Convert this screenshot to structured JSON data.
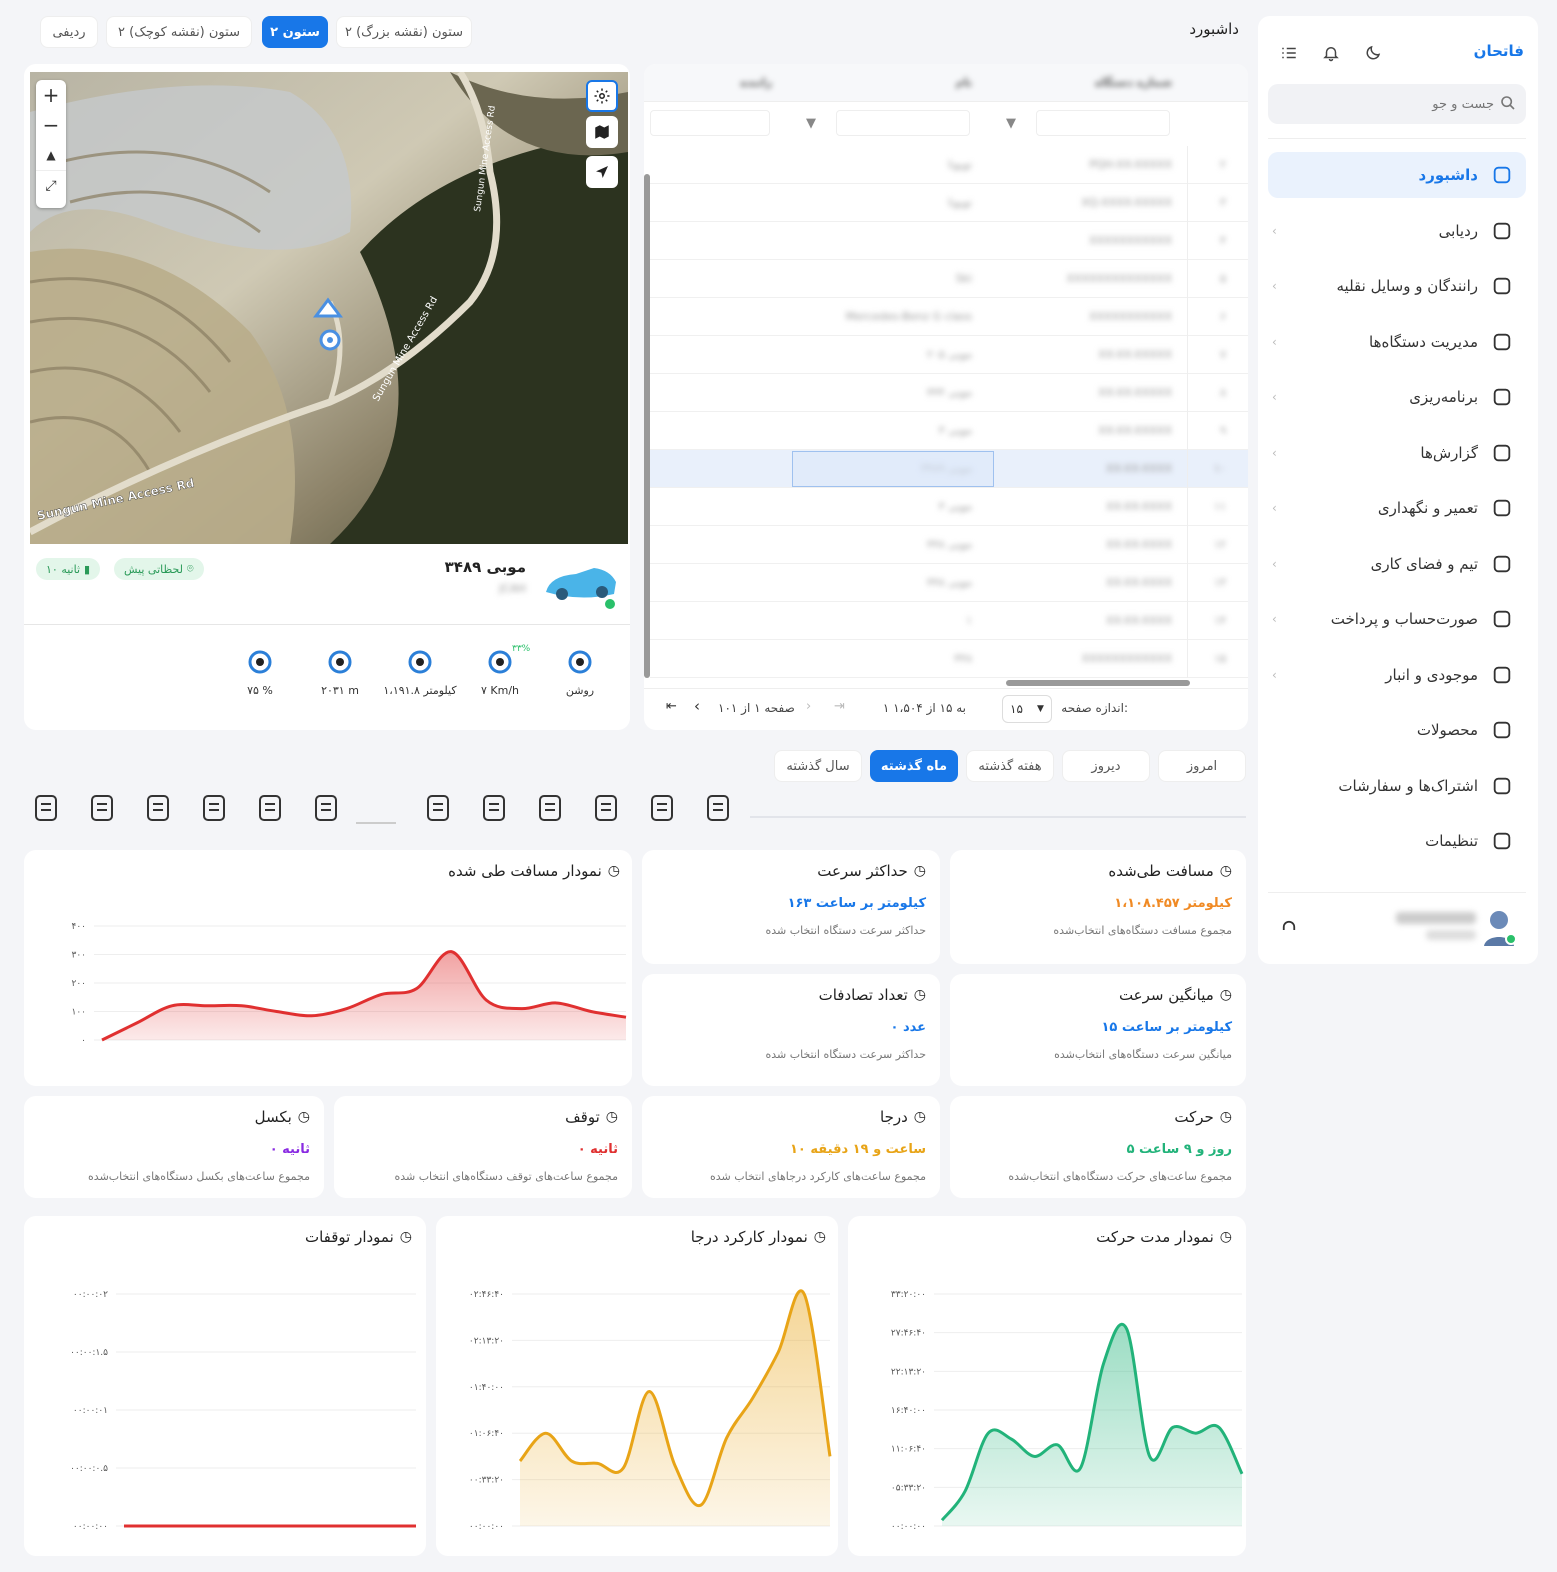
{
  "sidebar": {
    "brand": "فاتحان",
    "search_placeholder": "جست و جو",
    "items": [
      {
        "label": "داشبورد",
        "icon": "home-icon",
        "active": true
      },
      {
        "label": "ردیابی",
        "icon": "crosshair-icon"
      },
      {
        "label": "رانندگان و وسایل نقلیه",
        "icon": "car-icon"
      },
      {
        "label": "مدیریت دستگاه‌ها",
        "icon": "device-icon"
      },
      {
        "label": "برنامه‌ریزی",
        "icon": "clock-icon"
      },
      {
        "label": "گزارش‌ها",
        "icon": "bar-chart-icon"
      },
      {
        "label": "تعمیر و نگهداری",
        "icon": "maintenance-icon"
      },
      {
        "label": "تیم و فضای کاری",
        "icon": "team-icon"
      },
      {
        "label": "صورت‌حساب و پرداخت",
        "icon": "card-icon"
      },
      {
        "label": "موجودی و انبار",
        "icon": "warehouse-icon"
      },
      {
        "label": "محصولات",
        "icon": "boxes-icon"
      },
      {
        "label": "اشتراک‌ها و سفارشات",
        "icon": "cart-icon"
      },
      {
        "label": "تنظیمات",
        "icon": "gear-icon"
      }
    ]
  },
  "header": {
    "title": "داشبورد",
    "layouts": [
      {
        "label": "ردیفی",
        "on": false
      },
      {
        "label": "۲ ستون (نقشه کوچک)",
        "on": false
      },
      {
        "label": "۲ ستون",
        "on": true
      },
      {
        "label": "۲ ستون (نقشه بزرگ)",
        "on": false
      }
    ]
  },
  "table": {
    "columns": [
      "شماره دستگاه",
      "نام",
      "راننده"
    ],
    "rows": [
      {
        "n": "۲",
        "dev": "PQH-XX-XXXXX",
        "name": "تویوتا"
      },
      {
        "n": "۳",
        "dev": "XQ-XXXX-XXXXX",
        "name": "تویوتا"
      },
      {
        "n": "۴",
        "dev": "XXXXXXXXXXX",
        "name": ""
      },
      {
        "n": "۵",
        "dev": "XXXXXXXXXXXXXX",
        "name": "Ski"
      },
      {
        "n": "۶",
        "dev": "XXXXXXXXXXX",
        "name": "Mercedes-Benz G class"
      },
      {
        "n": "۷",
        "dev": "XX-XX-XXXXX",
        "name": "موبی ۲۰۵"
      },
      {
        "n": "۸",
        "dev": "XX-XX-XXXXX",
        "name": "موبی ۴۴۴"
      },
      {
        "n": "۹",
        "dev": "XX-XX-XXXXX",
        "name": "موبی ۳"
      },
      {
        "n": "۱۰",
        "dev": "XX-XX-XXXX",
        "name": "موبی ۳۴۸۹",
        "selected": true
      },
      {
        "n": "۱۱",
        "dev": "XX-XX-XXXX",
        "name": "موبی ۳"
      },
      {
        "n": "۱۲",
        "dev": "XX-XX-XXXX",
        "name": "موبی ۴۴۸"
      },
      {
        "n": "۱۳",
        "dev": "XX-XX-XXXX",
        "name": "موبی ۴۴۸"
      },
      {
        "n": "۱۴",
        "dev": "XX-XX-XXXX",
        "name": "۱"
      },
      {
        "n": "۱۵",
        "dev": "XXXXXXXXXXXX",
        "name": "۴۴۸"
      }
    ],
    "page_size_label": "اندازه صفحه:",
    "page_size": "۱۵",
    "range": "۱ به ۱۵ از ۱،۵۰۴",
    "page_info": "صفحه ۱ از ۱۰۱"
  },
  "map": {
    "road1": "Sungun Mine Access Rd",
    "road2": "Sungun Mine Access Rd",
    "road3": "Sungun Mine Access Rd",
    "vehicle_name": "موبی ۳۴۸۹",
    "vehicle_sub": "JCAH",
    "badge_live": "لحظاتی پیش",
    "badge_interval": "۱۰ ثانیه",
    "metrics": [
      {
        "icon": "ignition-icon",
        "label": "روشن"
      },
      {
        "icon": "speedometer-icon",
        "label": "۷ Km/h",
        "extra": "۳۳%"
      },
      {
        "icon": "route-icon",
        "label": "۱،۱۹۱.۸ کیلومتر"
      },
      {
        "icon": "altitude-icon",
        "label": "۲۰۳۱ m"
      },
      {
        "icon": "signal-icon",
        "label": "۷۵ %"
      }
    ]
  },
  "periods": [
    {
      "label": "امروز",
      "on": false
    },
    {
      "label": "دیروز",
      "on": false
    },
    {
      "label": "هفته گذشته",
      "on": false
    },
    {
      "label": "ماه گذشته",
      "on": true
    },
    {
      "label": "سال گذشته",
      "on": false
    }
  ],
  "toolbar_icons": [
    "report-icon",
    "route-pin-icon",
    "parking-icon",
    "alarm-icon",
    "database-icon",
    "coins-icon",
    "divider",
    "alarm-gear-icon",
    "settings-laptop-icon",
    "edit-icon",
    "location-pin-icon",
    "terminal-icon",
    "io-gear-icon"
  ],
  "stats": {
    "distance": {
      "title": "مسافت طی‌شده",
      "value": "۱،۱۰۸.۴۵۷ کیلومتر",
      "sub": "مجموع مسافت دستگاه‌های انتخاب‌شده",
      "color": "#f08a24"
    },
    "max_speed": {
      "title": "حداکثر سرعت",
      "value": "۱۶۳ کیلومتر بر ساعت",
      "sub": "حداکثر سرعت دستگاه انتخاب شده",
      "color": "#1877e8"
    },
    "avg_speed": {
      "title": "میانگین سرعت",
      "value": "۱۵ کیلومتر بر ساعت",
      "sub": "میانگین سرعت دستگاه‌های انتخاب‌شده",
      "color": "#1877e8"
    },
    "accidents": {
      "title": "تعداد تصادفات",
      "value": "۰ عدد",
      "sub": "حداکثر سرعت دستگاه انتخاب شده",
      "color": "#1877e8"
    },
    "moving": {
      "title": "حرکت",
      "value": "۵ روز و ۹ ساعت",
      "sub": "مجموع ساعت‌های حرکت دستگاه‌های انتخاب‌شده",
      "color": "#22b37a"
    },
    "pto": {
      "title": "درجا",
      "value": "۱۰ ساعت و ۱۹ دقیقه",
      "sub": "مجموع ساعت‌های کارکرد درجاهای انتخاب شده",
      "color": "#e8a417"
    },
    "stop": {
      "title": "توقف",
      "value": "۰ ثانیه",
      "sub": "مجموع ساعت‌های توقف دستگاه‌های انتخاب شده",
      "color": "#e03030"
    },
    "towing": {
      "title": "بکسل",
      "value": "۰ ثانیه",
      "sub": "مجموع ساعت‌های بکسل دستگاه‌های انتخاب‌شده",
      "color": "#8a2be2"
    }
  },
  "chart_data": [
    {
      "type": "area",
      "title": "نمودار مسافت طی شده",
      "ylim": [
        0,
        400
      ],
      "yticks": [
        "۰",
        "۱۰۰",
        "۲۰۰",
        "۳۰۰",
        "۴۰۰"
      ],
      "values": [
        0,
        60,
        120,
        120,
        120,
        100,
        85,
        110,
        160,
        180,
        310,
        140,
        110,
        130,
        100,
        80
      ],
      "color": "#e03030"
    },
    {
      "type": "area",
      "title": "نمودار مدت حرکت",
      "ylim": [
        0,
        200000
      ],
      "yticks": [
        "۰۰:۰۰:۰۰",
        "۰۵:۳۳:۲۰",
        "۱۱:۰۶:۴۰",
        "۱۶:۴۰:۰۰",
        "۲۲:۱۳:۲۰",
        "۲۷:۴۶:۴۰",
        "۳۳:۲۰:۰۰"
      ],
      "values": [
        5000,
        30000,
        80000,
        75000,
        60000,
        70000,
        50000,
        140000,
        170000,
        60000,
        85000,
        80000,
        85000,
        45000
      ],
      "color": "#22b37a"
    },
    {
      "type": "area",
      "title": "نمودار کارکرد درجا",
      "ylim": [
        0,
        10000
      ],
      "yticks": [
        "۰۰:۰۰:۰۰",
        "۰۰:۳۳:۲۰",
        "۰۱:۰۶:۴۰",
        "۰۱:۴۰:۰۰",
        "۰۲:۱۳:۲۰",
        "۰۲:۴۶:۴۰"
      ],
      "values": [
        2800,
        4000,
        2800,
        2700,
        2500,
        5800,
        2600,
        900,
        3800,
        5500,
        7500,
        10000,
        3000
      ],
      "color": "#e8a417"
    },
    {
      "type": "line",
      "title": "نمودار توقفات",
      "ylim": [
        0,
        2
      ],
      "yticks": [
        "۰۰:۰۰:۰۰",
        "۰۰:۰۰:۰.۵",
        "۰۰:۰۰:۰۱",
        "۰۰:۰۰:۱.۵",
        "۰۰:۰۰:۰۲"
      ],
      "values": [
        0,
        0,
        0,
        0,
        0,
        0,
        0,
        0
      ],
      "color": "#e03030"
    }
  ]
}
